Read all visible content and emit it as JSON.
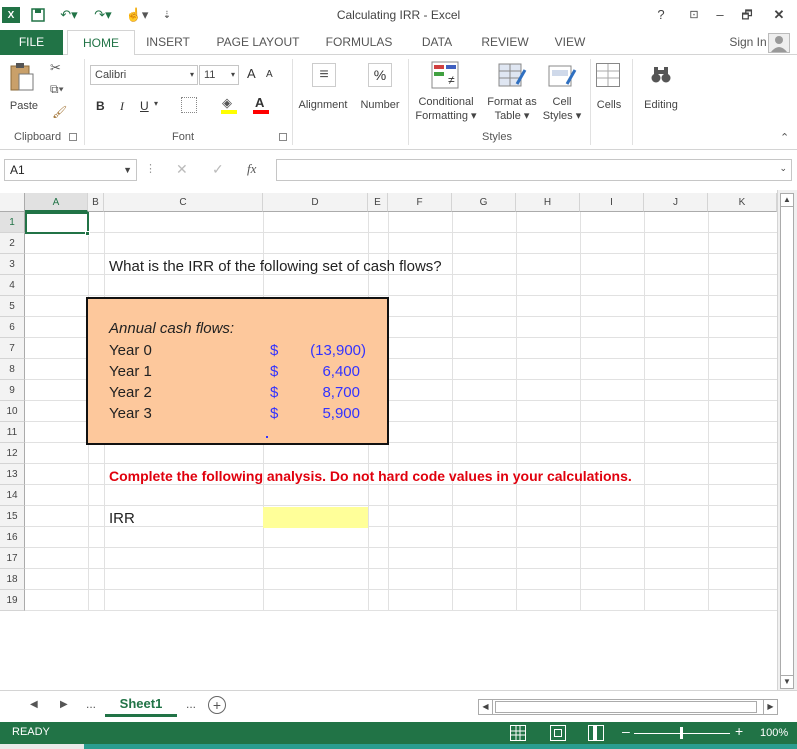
{
  "window": {
    "title": "Calculating IRR - Excel",
    "help": "?",
    "restore_ribbon": "⊡",
    "minimize": "–",
    "restore": "🗗",
    "close": "✕"
  },
  "tabs": [
    "FILE",
    "HOME",
    "INSERT",
    "PAGE LAYOUT",
    "FORMULAS",
    "DATA",
    "REVIEW",
    "VIEW"
  ],
  "sign_in": "Sign In",
  "ribbon": {
    "clipboard": {
      "paste": "Paste",
      "label": "Clipboard"
    },
    "font": {
      "name": "Calibri",
      "size": "11",
      "grow": "A",
      "shrink": "A",
      "bold": "B",
      "italic": "I",
      "underline": "U",
      "label": "Font"
    },
    "alignment": "Alignment",
    "number": "Number",
    "number_symbol": "%",
    "conditional": [
      "Conditional",
      "Formatting"
    ],
    "format_table": [
      "Format as",
      "Table"
    ],
    "cell_styles": [
      "Cell",
      "Styles"
    ],
    "styles_label": "Styles",
    "cells": "Cells",
    "editing": "Editing"
  },
  "formula_bar": {
    "name_box": "A1",
    "fx": "fx",
    "value": ""
  },
  "columns": [
    "A",
    "B",
    "C",
    "D",
    "E",
    "F",
    "G",
    "H",
    "I",
    "J",
    "K"
  ],
  "rows": [
    "1",
    "2",
    "3",
    "4",
    "5",
    "6",
    "7",
    "8",
    "9",
    "10",
    "11",
    "12",
    "13",
    "14",
    "15",
    "16",
    "17",
    "18",
    "19"
  ],
  "sheet": {
    "question": "What is the IRR of the following set of cash flows?",
    "cash_flow_heading": "Annual cash flows:",
    "cash_flows": [
      {
        "label": "Year 0",
        "currency": "$",
        "value": "(13,900)"
      },
      {
        "label": "Year 1",
        "currency": "$",
        "value": "6,400"
      },
      {
        "label": "Year 2",
        "currency": "$",
        "value": "8,700"
      },
      {
        "label": "Year 3",
        "currency": "$",
        "value": "5,900"
      }
    ],
    "instruction": "Complete the following analysis. Do not hard code values in your calculations.",
    "irr_label": "IRR",
    "irr_value": ""
  },
  "sheet_tabs": {
    "active": "Sheet1",
    "more_left": "...",
    "more_right": "...",
    "add": "+"
  },
  "status": {
    "mode": "READY",
    "zoom": "100%"
  },
  "colors": {
    "accent": "#217346",
    "input_fill": "#ffff99",
    "box_fill": "#fdc89c",
    "instruction": "#e0000d",
    "values": "#3333ff"
  }
}
